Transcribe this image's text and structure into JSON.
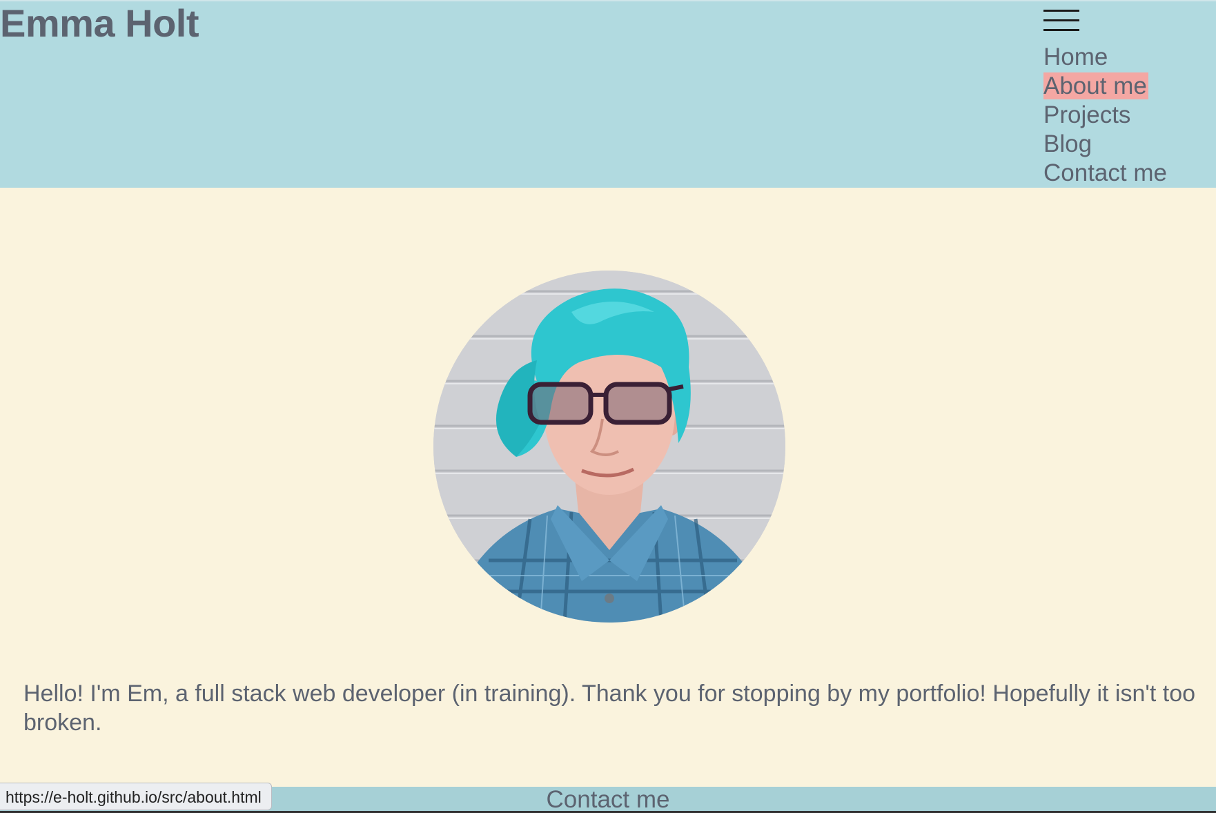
{
  "header": {
    "title": "Emma Holt",
    "menu_icon": "hamburger-menu-icon",
    "nav": [
      {
        "label": "Home",
        "active": false
      },
      {
        "label": "About me",
        "active": true
      },
      {
        "label": "Projects",
        "active": false
      },
      {
        "label": "Blog",
        "active": false
      },
      {
        "label": "Contact me",
        "active": false
      }
    ]
  },
  "main": {
    "intro": "Hello! I'm Em, a full stack web developer (in training). Thank you for stopping by my portfolio! Hopefully it isn't too broken."
  },
  "footer": {
    "contact_label": "Contact me"
  },
  "status_bar": {
    "url": "https://e-holt.github.io/src/about.html"
  },
  "colors": {
    "header_bg": "#b1dae0",
    "page_bg": "#faf3dd",
    "text": "#5c6370",
    "active_highlight": "#f4a7a3"
  }
}
